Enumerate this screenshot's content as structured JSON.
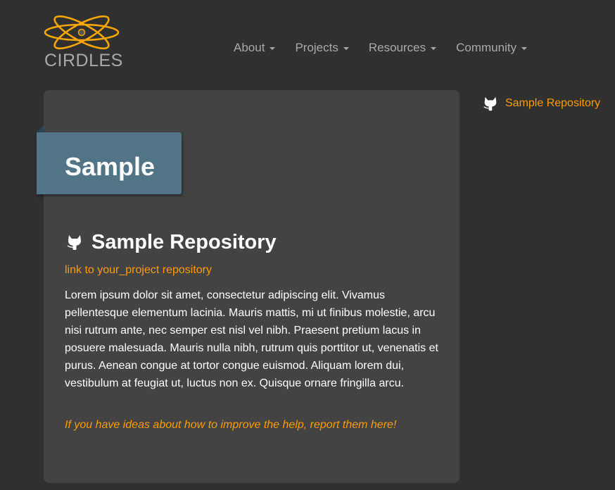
{
  "brand": {
    "name": "CIRDLES",
    "accent_color": "#f7a600"
  },
  "nav": {
    "items": [
      {
        "label": "About",
        "icon": "caret-down-icon"
      },
      {
        "label": "Projects",
        "icon": "caret-down-icon"
      },
      {
        "label": "Resources",
        "icon": "caret-down-icon"
      },
      {
        "label": "Community",
        "icon": "caret-down-icon"
      }
    ]
  },
  "page": {
    "ribbon_title": "Sample",
    "repo_heading": "Sample Repository",
    "repo_icon": "github-octocat-icon",
    "repo_link": "link to your_project repository",
    "body": "Lorem ipsum dolor sit amet, consectetur adipiscing elit. Vivamus pellentesque elementum lacinia. Mauris mattis, mi ut finibus molestie, arcu nisi rutrum ante, nec semper est nisl vel nibh. Praesent pretium lacus in posuere malesuada. Mauris nulla nibh, rutrum quis porttitor ut, venenatis et purus. Aenean congue at tortor congue euismod. Aliquam lorem dui, vestibulum at feugiat ut, luctus non ex. Quisque ornare fringilla arcu.",
    "help_link": "If you have ideas about how to improve the help, report them here!"
  },
  "sidebar": {
    "link_label": "Sample Repository",
    "link_icon": "github-octocat-icon"
  },
  "colors": {
    "background": "#303030",
    "panel": "#434343",
    "ribbon": "#517486",
    "link": "#ff9c00",
    "nav_text": "#a9a9a9"
  }
}
